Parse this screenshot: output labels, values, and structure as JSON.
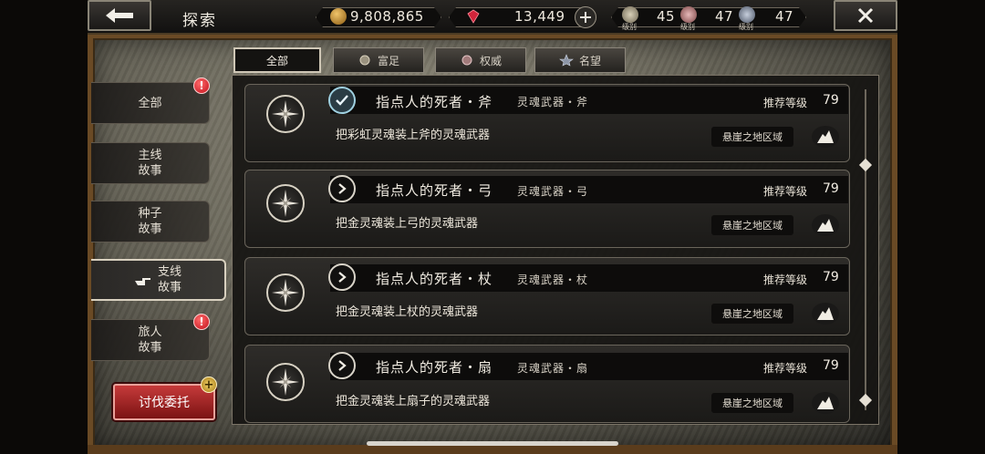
{
  "header": {
    "title": "探索",
    "gold": "9,808,865",
    "gems": "13,449",
    "levels": [
      {
        "icon": "wealth-rank-icon",
        "label": "级别",
        "value": "45"
      },
      {
        "icon": "authority-rank-icon",
        "label": "级别",
        "value": "47"
      },
      {
        "icon": "fame-rank-icon",
        "label": "级别",
        "value": "47"
      }
    ]
  },
  "filters": [
    {
      "label": "全部",
      "icon": "",
      "active": true
    },
    {
      "label": "富足",
      "icon": "wealth-icon",
      "active": false
    },
    {
      "label": "权威",
      "icon": "authority-icon",
      "active": false
    },
    {
      "label": "名望",
      "icon": "fame-icon",
      "active": false
    }
  ],
  "nav": [
    {
      "label": "全部",
      "badge": "!"
    },
    {
      "label": "主线\n故事",
      "badge": ""
    },
    {
      "label": "种子\n故事",
      "badge": ""
    },
    {
      "label": "支线\n故事",
      "badge": "",
      "active": true
    },
    {
      "label": "旅人\n故事",
      "badge": "!"
    }
  ],
  "subjugate_button": "讨伐委托",
  "plus_badge": "+",
  "quests": [
    {
      "title": "指点人的死者・斧",
      "category": "灵魂武器・斧",
      "rec_label": "推荐等级",
      "rec_level": "79",
      "desc": "把彩虹灵魂装上斧的灵魂武器",
      "region": "悬崖之地区域",
      "status": "completed"
    },
    {
      "title": "指点人的死者・弓",
      "category": "灵魂武器・弓",
      "rec_label": "推荐等级",
      "rec_level": "79",
      "desc": "把金灵魂装上弓的灵魂武器",
      "region": "悬崖之地区域",
      "status": "go"
    },
    {
      "title": "指点人的死者・杖",
      "category": "灵魂武器・杖",
      "rec_label": "推荐等级",
      "rec_level": "79",
      "desc": "把金灵魂装上杖的灵魂武器",
      "region": "悬崖之地区域",
      "status": "go"
    },
    {
      "title": "指点人的死者・扇",
      "category": "灵魂武器・扇",
      "rec_label": "推荐等级",
      "rec_level": "79",
      "desc": "把金灵魂装上扇子的灵魂武器",
      "region": "悬崖之地区域",
      "status": "go"
    }
  ],
  "colors": {
    "accent_red": "#c63a3a",
    "frame_brown": "#6a4a25",
    "gold_coin": "#c9912f",
    "gem_red": "#d0243a"
  }
}
